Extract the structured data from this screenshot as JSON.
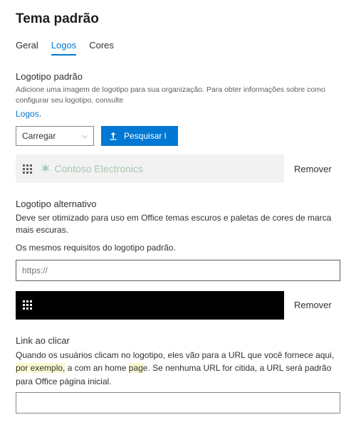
{
  "title": "Tema padrão",
  "tabs": {
    "general": "Geral",
    "logos": "Logos",
    "colors": "Cores"
  },
  "default_logo": {
    "label": "Logotipo padrão",
    "helper": "Adicione uma imagem de logotipo para sua organização. Para obter informações sobre como configurar seu logotipo, consulte",
    "helper_link": "Logos",
    "upload_label": "Carregar",
    "search_label": "Pesquisar l",
    "preview_text": "Contoso Electronics",
    "remove": "Remover"
  },
  "alt_logo": {
    "label": "Logotipo alternativo",
    "desc1": "Deve ser otimizado para uso em Office temas escuros e paletas de cores de marca mais escuras.",
    "desc2": "Os mesmos requisitos do logotipo padrão.",
    "placeholder": "https://",
    "remove": "Remover"
  },
  "click_link": {
    "label": "Link ao clicar",
    "desc_a": "Quando os usuários clicam no logotipo, eles vão para a URL que você fornece aqui, ",
    "desc_b": "por exemplo,",
    "desc_c": " a com an home ",
    "desc_d": "pag",
    "desc_e": "e. Se nenhuma URL for citida, a URL será padrão para Office página inicial."
  }
}
